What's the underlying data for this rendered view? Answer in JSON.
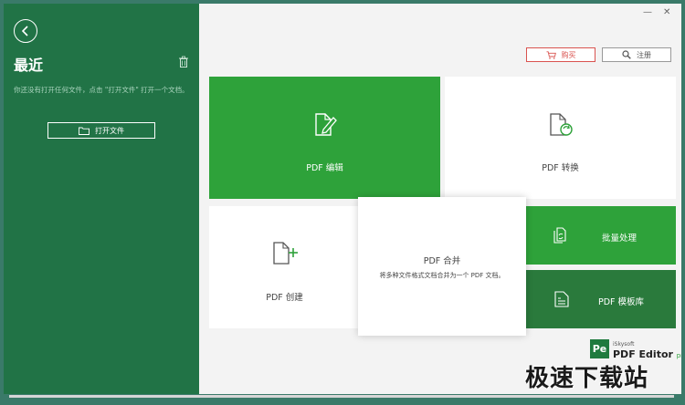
{
  "window": {
    "minimize": "—",
    "close": "✕"
  },
  "sidebar": {
    "title": "最近",
    "empty_hint": "你还没有打开任何文件，点击 \"打开文件\" 打开一个文档。",
    "open_file_label": "打开文件"
  },
  "header": {
    "buy_label": "购买",
    "register_label": "注册"
  },
  "tiles": {
    "edit": {
      "label": "PDF 编辑"
    },
    "convert": {
      "label": "PDF 转换"
    },
    "create": {
      "label": "PDF 创建"
    },
    "merge": {
      "label": "PDF 合并",
      "description": "将多种文件格式文档合并为一个 PDF 文档。"
    },
    "batch": {
      "label": "批量处理"
    },
    "template": {
      "label": "PDF 模板库"
    }
  },
  "logo": {
    "badge": "Pe",
    "brand": "iSkysoft",
    "name": "PDF Editor",
    "edition": "pro"
  },
  "watermark": "极速下载站",
  "colors": {
    "sidebar": "#217346",
    "accent_green": "#2ea23a",
    "dark_green": "#2a7a3c",
    "buy_red": "#d9534f"
  }
}
